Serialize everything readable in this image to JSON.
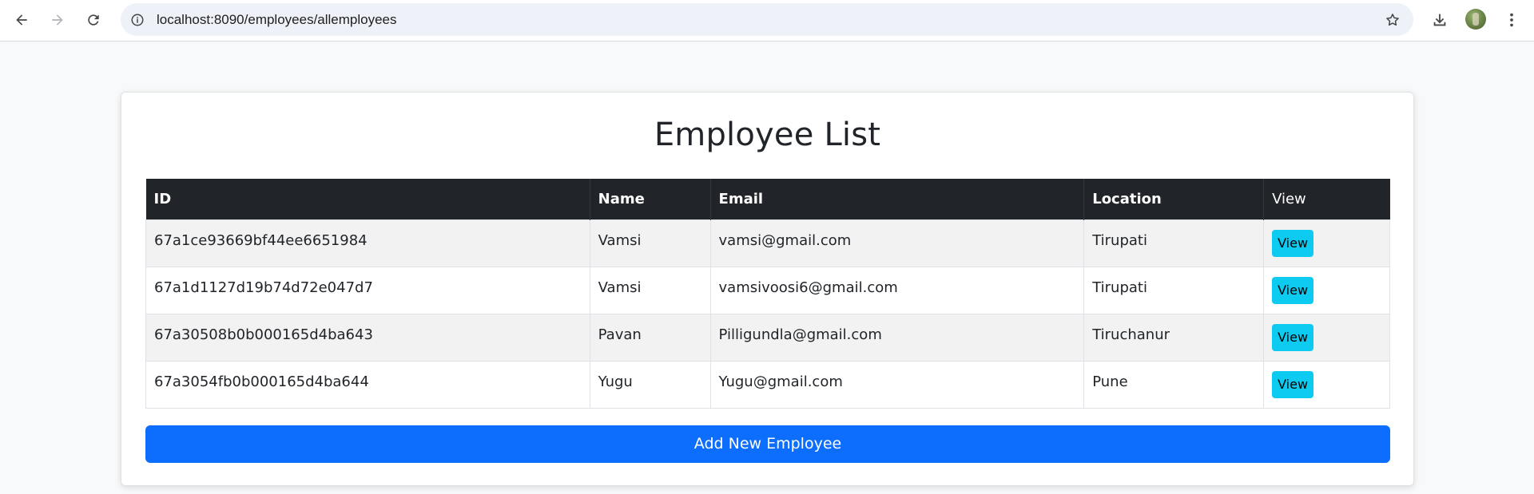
{
  "browser": {
    "url": "localhost:8090/employees/allemployees",
    "icons": {
      "back": "back-arrow-icon",
      "forward": "forward-arrow-icon",
      "reload": "reload-icon",
      "site_info": "info-icon",
      "bookmark": "star-icon",
      "download": "download-icon",
      "profile": "avatar",
      "menu": "more-vert-icon"
    }
  },
  "page": {
    "title": "Employee List",
    "table": {
      "headers": [
        "ID",
        "Name",
        "Email",
        "Location",
        "View"
      ],
      "rows": [
        {
          "id": "67a1ce93669bf44ee6651984",
          "name": "Vamsi",
          "email": "vamsi@gmail.com",
          "location": "Tirupati",
          "action": "View"
        },
        {
          "id": "67a1d1127d19b74d72e047d7",
          "name": "Vamsi",
          "email": "vamsivoosi6@gmail.com",
          "location": "Tirupati",
          "action": "View"
        },
        {
          "id": "67a30508b0b000165d4ba643",
          "name": "Pavan",
          "email": "Pilligundla@gmail.com",
          "location": "Tiruchanur",
          "action": "View"
        },
        {
          "id": "67a3054fb0b000165d4ba644",
          "name": "Yugu",
          "email": "Yugu@gmail.com",
          "location": "Pune",
          "action": "View"
        }
      ]
    },
    "add_button_label": "Add New Employee"
  },
  "colors": {
    "header_bg": "#212529",
    "view_button": "#0dcaf0",
    "primary_button": "#0d6efd",
    "page_bg": "#f8f9fa"
  }
}
